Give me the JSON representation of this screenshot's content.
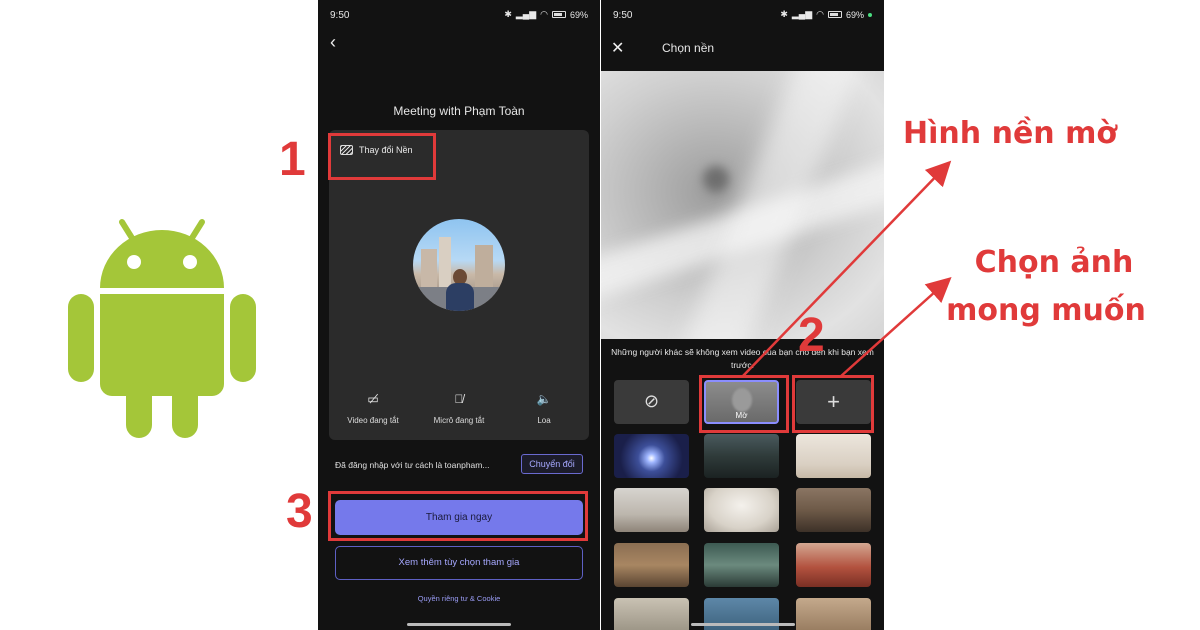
{
  "status_bar": {
    "time": "9:50",
    "battery": "69"
  },
  "meeting_screen": {
    "title": "Meeting with Phạm Toàn",
    "change_background": "Thay đổi Nền",
    "controls": [
      {
        "label": "Video đang tắt",
        "icon": "camera-off-icon"
      },
      {
        "label": "Micrô đang tắt",
        "icon": "mic-off-icon"
      },
      {
        "label": "Loa",
        "icon": "speaker-icon"
      }
    ],
    "signed_in_text": "Đã đăng nhập với tư cách là toanpham...",
    "switch_label": "Chuyển đổi",
    "join_label": "Tham gia ngay",
    "more_options_label": "Xem thêm tùy chọn tham gia",
    "privacy_label": "Quyền riêng tư & Cookie"
  },
  "background_screen": {
    "title": "Chọn nền",
    "notice": "Những người khác sẽ không xem video của bạn cho đến khi bạn xem trước.",
    "blur_label": "Mờ",
    "backgrounds": [
      "space-scene",
      "mountain-lake",
      "white-room",
      "living-room",
      "arched-room",
      "wood-room",
      "library",
      "glass-house",
      "red-room",
      "tile-10",
      "tile-11",
      "tile-12"
    ]
  },
  "annotations": {
    "step1": "1",
    "step2": "2",
    "step3": "3",
    "blur_callout": "Hình nền mờ",
    "choose_callout_line1": "Chọn ảnh",
    "choose_callout_line2": "mong muốn"
  },
  "colors": {
    "accent": "#7579eb",
    "annotation": "#e03a3a",
    "android_green": "#a4c639"
  }
}
